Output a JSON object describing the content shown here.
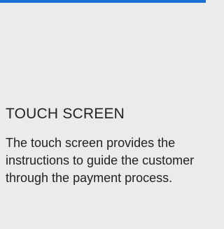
{
  "colors": {
    "accent": "#1a6fd6",
    "background": "#ebebeb",
    "text": "#222222"
  },
  "feature": {
    "title": "TOUCH SCREEN",
    "description": "The touch screen provides the instructions to guide the customer through the payment process."
  }
}
